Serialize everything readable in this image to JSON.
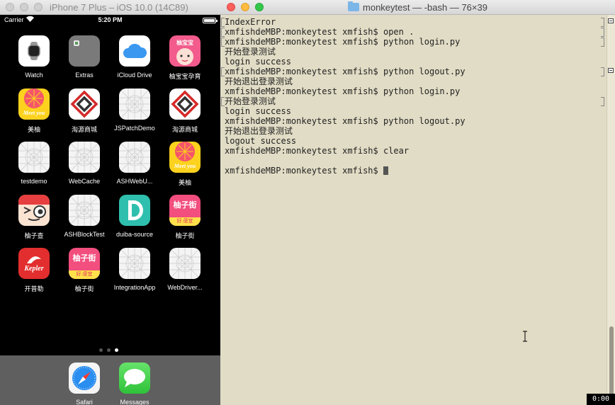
{
  "simulator": {
    "title": "iPhone 7 Plus – iOS 10.0 (14C89)",
    "status": {
      "carrier": "Carrier",
      "time": "5:20 PM",
      "battery_level": 1.0
    },
    "apps": [
      {
        "label": "Watch",
        "icon": "watch-icon"
      },
      {
        "label": "Extras",
        "icon": "folder-icon"
      },
      {
        "label": "iCloud Drive",
        "icon": "cloud-icon"
      },
      {
        "label": "柚宝宝孕育",
        "icon": "baby-face-icon",
        "badge": "柚宝宝"
      },
      {
        "label": "美柚",
        "icon": "grapefruit-icon",
        "badge": "Meet you"
      },
      {
        "label": "淘源商城",
        "icon": "red-diamond-logo-icon"
      },
      {
        "label": "JSPatchDemo",
        "icon": "blank-app-icon"
      },
      {
        "label": "淘源商城",
        "icon": "red-diamond-logo-icon"
      },
      {
        "label": "testdemo",
        "icon": "blank-app-icon"
      },
      {
        "label": "WebCache",
        "icon": "blank-app-icon"
      },
      {
        "label": "ASHWebU...",
        "icon": "blank-app-icon"
      },
      {
        "label": "美柚",
        "icon": "grapefruit-icon",
        "badge": "Meet you"
      },
      {
        "label": "柚子查",
        "icon": "cartoon-face-icon"
      },
      {
        "label": "ASHBlockTest",
        "icon": "blank-app-icon"
      },
      {
        "label": "duiba-source",
        "icon": "d-letter-icon"
      },
      {
        "label": "柚子街",
        "icon": "yoshop-icon",
        "badge": "柚子街",
        "sub": "好.便宜"
      },
      {
        "label": "开普勒",
        "icon": "kepler-icon",
        "badge": "Kepler"
      },
      {
        "label": "柚子街",
        "icon": "yoshop-icon",
        "badge": "柚子街",
        "sub": "好.便宜"
      },
      {
        "label": "IntegrationApp",
        "icon": "blank-app-icon"
      },
      {
        "label": "WebDriver...",
        "icon": "blank-app-icon"
      }
    ],
    "page_count": 3,
    "active_page": 3,
    "dock": [
      {
        "label": "Safari",
        "icon": "compass-icon"
      },
      {
        "label": "Messages",
        "icon": "speech-bubble-icon"
      }
    ]
  },
  "terminal": {
    "title": "monkeytest — -bash — 76×39",
    "lines": [
      {
        "text": "IndexError",
        "marked": true
      },
      {
        "text": "xmfishdeMBP:monkeytest xmfish$ open .",
        "marked": true
      },
      {
        "text": "xmfishdeMBP:monkeytest xmfish$ python login.py",
        "marked": true
      },
      {
        "text": "开始登录测试",
        "marked": false
      },
      {
        "text": "login success",
        "marked": false
      },
      {
        "text": "xmfishdeMBP:monkeytest xmfish$ python logout.py",
        "marked": true
      },
      {
        "text": "开始退出登录测试",
        "marked": false
      },
      {
        "text": "xmfishdeMBP:monkeytest xmfish$ python login.py",
        "marked": false
      },
      {
        "text": "开始登录测试",
        "marked": true
      },
      {
        "text": "login success",
        "marked": false
      },
      {
        "text": "xmfishdeMBP:monkeytest xmfish$ python logout.py",
        "marked": false
      },
      {
        "text": "开始退出登录测试",
        "marked": false
      },
      {
        "text": "logout success",
        "marked": false
      },
      {
        "text": "xmfishdeMBP:monkeytest xmfish$ clear",
        "marked": false
      },
      {
        "text": "",
        "marked": false
      },
      {
        "text": "xmfishdeMBP:monkeytest xmfish$ ",
        "marked": false,
        "cursor": true
      }
    ],
    "recording_time": "0:00"
  },
  "colors": {
    "terminal_bg": "#e1dcc5",
    "terminal_text": "#222222",
    "simulator_bg": "#000000"
  }
}
